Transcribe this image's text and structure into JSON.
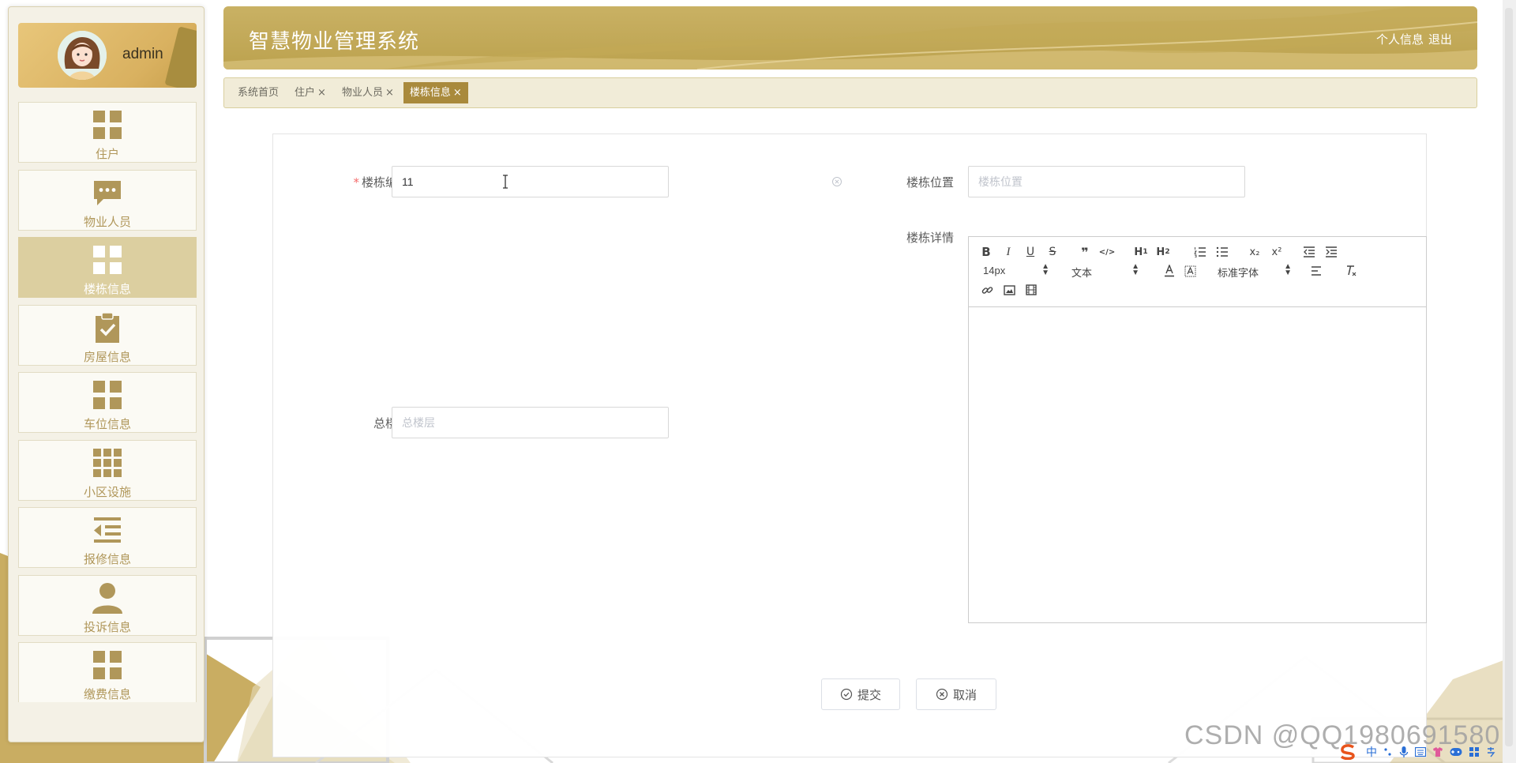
{
  "colors": {
    "accent": "#a98a3c",
    "gold": "#c7ad5f",
    "header": "#bca24e",
    "required": "#f56c6c"
  },
  "user": {
    "name": "admin"
  },
  "sidebar": {
    "items": [
      {
        "label": "住户",
        "icon": "grid-icon"
      },
      {
        "label": "物业人员",
        "icon": "chat-icon"
      },
      {
        "label": "楼栋信息",
        "icon": "grid-icon",
        "active": true
      },
      {
        "label": "房屋信息",
        "icon": "clipboard-check-icon"
      },
      {
        "label": "车位信息",
        "icon": "grid-icon"
      },
      {
        "label": "小区设施",
        "icon": "grid-nine-icon"
      },
      {
        "label": "报修信息",
        "icon": "list-indent-icon"
      },
      {
        "label": "投诉信息",
        "icon": "user-icon"
      },
      {
        "label": "缴费信息",
        "icon": "grid-icon"
      }
    ]
  },
  "header": {
    "title": "智慧物业管理系统",
    "profile_link": "个人信息",
    "logout_link": "退出"
  },
  "tabs": [
    {
      "label": "系统首页",
      "closable": false
    },
    {
      "label": "住户",
      "closable": true
    },
    {
      "label": "物业人员",
      "closable": true
    },
    {
      "label": "楼栋信息",
      "closable": true,
      "active": true
    }
  ],
  "tab_close": "×",
  "form": {
    "building_no": {
      "label": "楼栋编号",
      "required_mark": "*",
      "value": "11"
    },
    "location": {
      "label": "楼栋位置",
      "placeholder": "楼栋位置",
      "value": ""
    },
    "details": {
      "label": "楼栋详情"
    },
    "floors": {
      "label": "总楼层",
      "placeholder": "总楼层",
      "value": ""
    }
  },
  "editor": {
    "buttons_row1": [
      "B",
      "I",
      "U",
      "S",
      "❞",
      "</>",
      "H1",
      "H2",
      "ol",
      "ul",
      "x₂",
      "x²",
      "outdent",
      "indent"
    ],
    "size_select": "14px",
    "header_select": "文本",
    "font_select": "标准字体",
    "heading_labels": {
      "h1": "H",
      "h1_sub": "1",
      "h2": "H",
      "h2_sub": "2"
    }
  },
  "actions": {
    "submit": "提交",
    "cancel": "取消"
  },
  "watermark": "CSDN @QQ1980691580",
  "tray": {
    "ime": "中"
  }
}
